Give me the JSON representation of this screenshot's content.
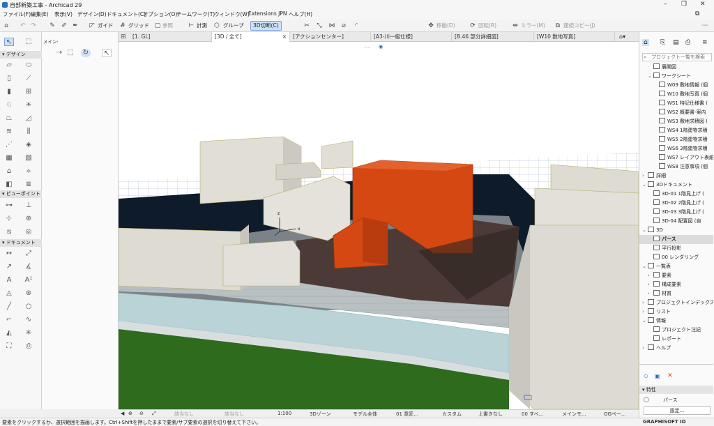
{
  "window": {
    "title": "自部新築工事 - Archicad 29",
    "controls": [
      "–",
      "❐",
      "✕"
    ]
  },
  "menubar": [
    "ファイル(F)",
    "編集(E)",
    "表示(V)",
    "デザイン(D)",
    "ドキュメント(C)",
    "オプション(O)",
    "チームワーク(T)",
    "ウィンドウ(W)",
    "Extensions JPN",
    "ヘルプ(H)"
  ],
  "toolbar": {
    "guide": "ガイド",
    "grid": "グリッド",
    "reference": "参照",
    "measure": "計測",
    "group": "グループ",
    "cut3d": "3D切断(C)",
    "move": "移動(D)",
    "rotate": "回転(R)",
    "mirror": "ミラー(M)",
    "multicopy": "連続コピー(J)"
  },
  "toolbox": {
    "top_label": "メイン:",
    "sections": {
      "design": "デザイン",
      "viewpoint": "ビューポイント",
      "document": "ドキュメント"
    }
  },
  "tabs": [
    "[1. GL]",
    "[3D / 全て]",
    "[アクションセンター]",
    "[A3-川一級仕様]",
    "[B.46 部分詳細図]",
    "[W10 敷地写真]"
  ],
  "active_tab_index": 1,
  "axis": {
    "z": "z",
    "x": "x"
  },
  "navigator": {
    "search_placeholder": "プロジェクト一覧を検索",
    "items": [
      {
        "label": "展開図",
        "level": 1,
        "chev": ""
      },
      {
        "label": "ワークシート",
        "level": 1,
        "chev": "⌄"
      },
      {
        "label": "W09 敷地情報 (個",
        "level": 2,
        "chev": ""
      },
      {
        "label": "W10 敷地写真 (個",
        "level": 2,
        "chev": ""
      },
      {
        "label": "WS1 特記仕様書 (",
        "level": 2,
        "chev": ""
      },
      {
        "label": "WS2 概要書-案内",
        "level": 2,
        "chev": ""
      },
      {
        "label": "WS3 敷地求積図 (",
        "level": 2,
        "chev": ""
      },
      {
        "label": "WS4 1階建物求積",
        "level": 2,
        "chev": ""
      },
      {
        "label": "WS5 2階建物求積",
        "level": 2,
        "chev": ""
      },
      {
        "label": "WS6 3階建物求積",
        "level": 2,
        "chev": ""
      },
      {
        "label": "WS7 レイアウト表紙",
        "level": 2,
        "chev": ""
      },
      {
        "label": "WS8 注意事項 (個",
        "level": 2,
        "chev": ""
      },
      {
        "label": "詳細",
        "level": 0,
        "chev": "›"
      },
      {
        "label": "3Dドキュメント",
        "level": 0,
        "chev": "⌄"
      },
      {
        "label": "3D-01 1階見上げ (",
        "level": 1,
        "chev": ""
      },
      {
        "label": "3D-02 2階見上げ (",
        "level": 1,
        "chev": ""
      },
      {
        "label": "3D-03 3階見上げ (",
        "level": 1,
        "chev": ""
      },
      {
        "label": "3D-04 配置図 (自",
        "level": 1,
        "chev": ""
      },
      {
        "label": "3D",
        "level": 0,
        "chev": "⌄"
      },
      {
        "label": "パース",
        "level": 1,
        "chev": "",
        "selected": true
      },
      {
        "label": "平行投影",
        "level": 1,
        "chev": ""
      },
      {
        "label": "00 レンダリング",
        "level": 1,
        "chev": ""
      },
      {
        "label": "一覧表",
        "level": 0,
        "chev": "⌄"
      },
      {
        "label": "要素",
        "level": 1,
        "chev": "›"
      },
      {
        "label": "構成要素",
        "level": 1,
        "chev": "›"
      },
      {
        "label": "材質",
        "level": 1,
        "chev": "›"
      },
      {
        "label": "プロジェクトインデックス",
        "level": 0,
        "chev": "›"
      },
      {
        "label": "リスト",
        "level": 0,
        "chev": "›"
      },
      {
        "label": "情報",
        "level": 0,
        "chev": "⌄"
      },
      {
        "label": "プロジェクト注記",
        "level": 1,
        "chev": ""
      },
      {
        "label": "レポート",
        "level": 1,
        "chev": ""
      },
      {
        "label": "ヘルプ",
        "level": 0,
        "chev": "›"
      }
    ],
    "properties_header": "特性",
    "properties_value": "パース",
    "settings_button": "設定..."
  },
  "bottombar": {
    "undo_zoom": "該当なし",
    "redo_zoom": "該当なし",
    "scale": "1:100",
    "zone": "3Dゾーン",
    "model": "モデル全体",
    "layer": "01 意匠...",
    "pen": "カスタム",
    "override": "上書きなし",
    "renovation": "00 すべ...",
    "mep": "メインモ...",
    "og": "OGペー..."
  },
  "status": {
    "message": "要素をクリックするか、選択範囲を描画します。Ctrl+Shiftを押したままで要素/サブ要素の選択を切り替えて下さい。",
    "brand": "GRAPHISOFT ID"
  },
  "colors": {
    "accent": "#d84a12",
    "grass": "#2f6b1c",
    "water": "#0d1a2a",
    "terrace": "#4b3a36"
  }
}
